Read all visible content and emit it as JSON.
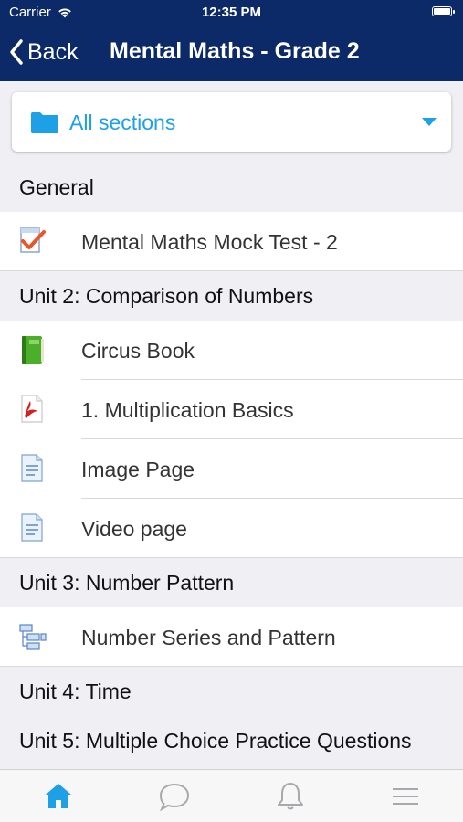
{
  "status_bar": {
    "carrier": "Carrier",
    "time": "12:35 PM"
  },
  "nav": {
    "back_label": "Back",
    "title": "Mental Maths - Grade 2"
  },
  "section_filter": {
    "selected": "All sections"
  },
  "sections": [
    {
      "title": "General",
      "items": [
        {
          "label": "Mental Maths Mock Test - 2",
          "icon": "quiz-icon"
        }
      ]
    },
    {
      "title": "Unit 2: Comparison of Numbers",
      "items": [
        {
          "label": "Circus Book",
          "icon": "book-icon"
        },
        {
          "label": "1. Multiplication Basics",
          "icon": "pdf-icon"
        },
        {
          "label": "Image Page",
          "icon": "page-icon"
        },
        {
          "label": "Video page",
          "icon": "page-icon"
        }
      ]
    },
    {
      "title": "Unit 3: Number Pattern",
      "items": [
        {
          "label": "Number Series and Pattern",
          "icon": "glossary-icon"
        }
      ]
    },
    {
      "title": "Unit 4: Time",
      "items": []
    },
    {
      "title": "Unit 5: Multiple Choice Practice Questions",
      "items": []
    }
  ],
  "tab_bar": {
    "tabs": [
      {
        "icon": "home-icon",
        "active": true
      },
      {
        "icon": "chat-icon",
        "active": false
      },
      {
        "icon": "bell-icon",
        "active": false
      },
      {
        "icon": "menu-icon",
        "active": false
      }
    ]
  },
  "colors": {
    "nav_bg": "#0b2a67",
    "accent": "#1ea0e6",
    "inactive_tab": "#a8a8ad"
  }
}
